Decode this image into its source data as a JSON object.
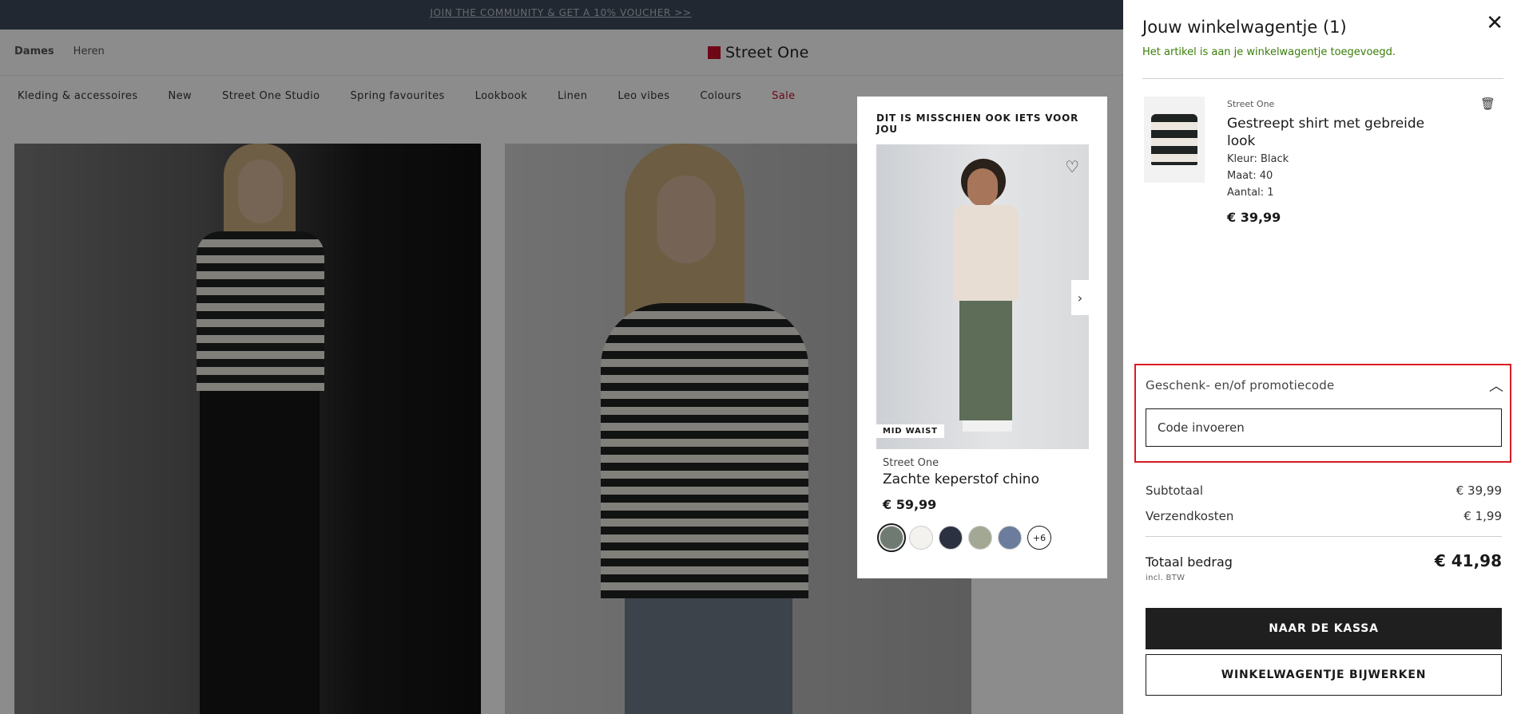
{
  "promo_bar": {
    "text": "JOIN THE COMMUNITY & GET A 10% VOUCHER >>"
  },
  "header": {
    "gender_nav": [
      "Dames",
      "Heren"
    ],
    "logo_text": "Street One"
  },
  "category_nav": [
    "Kleding & accessoires",
    "New",
    "Street One Studio",
    "Spring favourites",
    "Lookbook",
    "Linen",
    "Leo vibes",
    "Colours",
    "Sale"
  ],
  "recommendation": {
    "title": "DIT IS MISSCHIEN OOK IETS VOOR JOU",
    "badge": "MID WAIST",
    "brand": "Street One",
    "name": "Zachte keperstof chino",
    "price": "€ 59,99",
    "swatch_colors": [
      "#6f7a72",
      "#f3f2ef",
      "#2b3140",
      "#a3a894",
      "#6b7c9c"
    ],
    "more_colors": "+6"
  },
  "cart": {
    "title": "Jouw winkelwagentje (1)",
    "added_message": "Het artikel is aan je winkelwagentje toegevoegd.",
    "item": {
      "brand": "Street One",
      "name": "Gestreept shirt met gebreide look",
      "color": "Kleur: Black",
      "size": "Maat: 40",
      "quantity": "Aantal: 1",
      "price": "€ 39,99"
    },
    "promo": {
      "label": "Geschenk- en/of promotiecode",
      "placeholder": "Code invoeren",
      "value": ""
    },
    "subtotal_label": "Subtotaal",
    "subtotal_value": "€ 39,99",
    "shipping_label": "Verzendkosten",
    "shipping_value": "€ 1,99",
    "total_label": "Totaal bedrag",
    "total_value": "€ 41,98",
    "incl_vat": "incl. BTW",
    "checkout_label": "NAAR DE KASSA",
    "update_label": "WINKELWAGENTJE BIJWERKEN"
  },
  "colors": {
    "accent_red": "#c8102e",
    "success_green": "#3a7d0a",
    "highlight_border": "#d81b24"
  }
}
